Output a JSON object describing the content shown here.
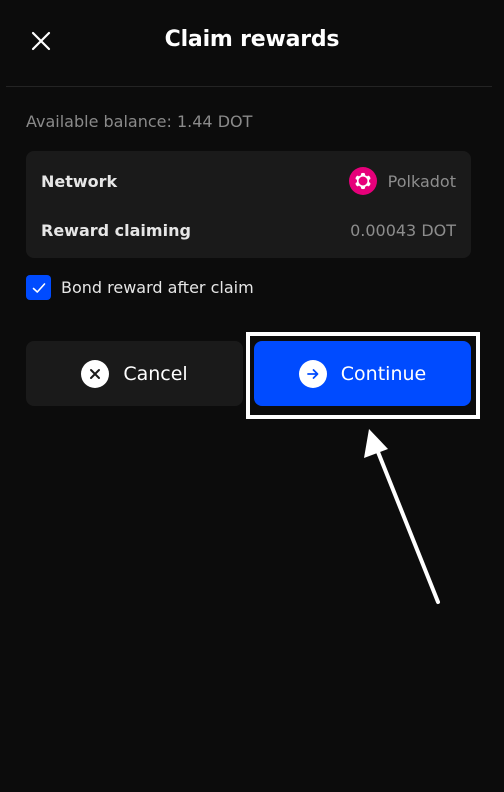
{
  "header": {
    "title": "Claim rewards",
    "close_icon": "close-icon"
  },
  "balance": {
    "text": "Available balance: 1.44 DOT"
  },
  "info": {
    "network_label": "Network",
    "network_value": "Polkadot",
    "network_icon": "polkadot-logo",
    "reward_label": "Reward claiming",
    "reward_value": "0.00043 DOT"
  },
  "options": {
    "bond_label": "Bond reward after claim",
    "bond_checked": true
  },
  "actions": {
    "cancel_label": "Cancel",
    "cancel_icon": "close-circle-icon",
    "continue_label": "Continue",
    "continue_icon": "arrow-right-circle-icon"
  },
  "colors": {
    "background": "#0c0c0c",
    "card": "#1a1a1a",
    "accent": "#004bff",
    "polkadot": "#e6007a"
  }
}
